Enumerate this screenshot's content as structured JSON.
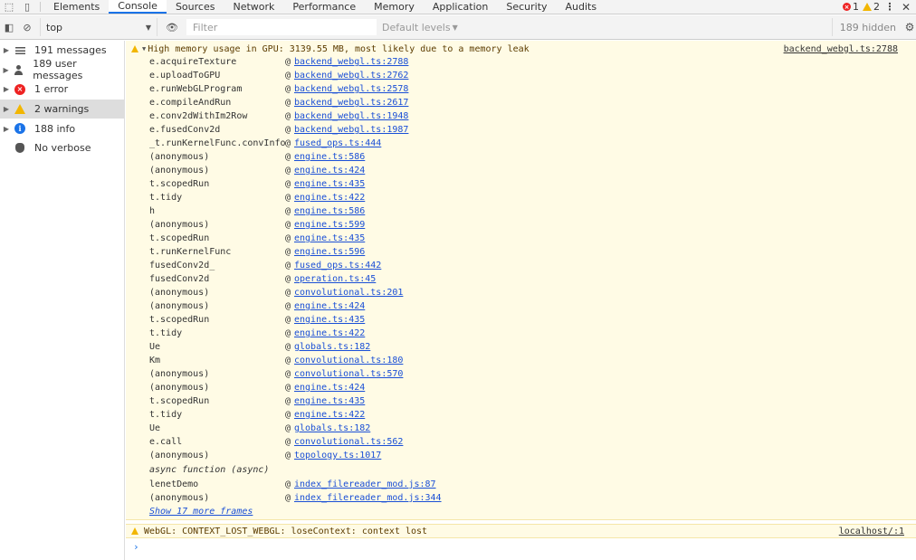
{
  "tabs": [
    "Elements",
    "Console",
    "Sources",
    "Network",
    "Performance",
    "Memory",
    "Application",
    "Security",
    "Audits"
  ],
  "active_tab": "Console",
  "status": {
    "errors": "1",
    "warnings": "2"
  },
  "toolbar": {
    "context": "top",
    "filter_placeholder": "Filter",
    "levels": "Default levels",
    "hidden": "189 hidden"
  },
  "sidebar": {
    "items": [
      {
        "label": "191 messages",
        "icon": "list-icon"
      },
      {
        "label": "189 user messages",
        "icon": "user-icon"
      },
      {
        "label": "1 error",
        "icon": "error-icon"
      },
      {
        "label": "2 warnings",
        "icon": "warning-icon"
      },
      {
        "label": "188 info",
        "icon": "info-icon"
      },
      {
        "label": "No verbose",
        "icon": "bug-icon"
      }
    ]
  },
  "warning": {
    "message": "High memory usage in GPU: 3139.55 MB, most likely due to a memory leak",
    "source": "backend_webgl.ts:2788",
    "frames": [
      {
        "fn": "e.acquireTexture",
        "link": "backend_webgl.ts:2788"
      },
      {
        "fn": "e.uploadToGPU",
        "link": "backend_webgl.ts:2762"
      },
      {
        "fn": "e.runWebGLProgram",
        "link": "backend_webgl.ts:2578"
      },
      {
        "fn": "e.compileAndRun",
        "link": "backend_webgl.ts:2617"
      },
      {
        "fn": "e.conv2dWithIm2Row",
        "link": "backend_webgl.ts:1948"
      },
      {
        "fn": "e.fusedConv2d",
        "link": "backend_webgl.ts:1987"
      },
      {
        "fn": "_t.runKernelFunc.convInfo",
        "link": "fused_ops.ts:444"
      },
      {
        "fn": "(anonymous)",
        "link": "engine.ts:586"
      },
      {
        "fn": "(anonymous)",
        "link": "engine.ts:424"
      },
      {
        "fn": "t.scopedRun",
        "link": "engine.ts:435"
      },
      {
        "fn": "t.tidy",
        "link": "engine.ts:422"
      },
      {
        "fn": "h",
        "link": "engine.ts:586"
      },
      {
        "fn": "(anonymous)",
        "link": "engine.ts:599"
      },
      {
        "fn": "t.scopedRun",
        "link": "engine.ts:435"
      },
      {
        "fn": "t.runKernelFunc",
        "link": "engine.ts:596"
      },
      {
        "fn": "fusedConv2d_",
        "link": "fused_ops.ts:442"
      },
      {
        "fn": "fusedConv2d",
        "link": "operation.ts:45"
      },
      {
        "fn": "(anonymous)",
        "link": "convolutional.ts:201"
      },
      {
        "fn": "(anonymous)",
        "link": "engine.ts:424"
      },
      {
        "fn": "t.scopedRun",
        "link": "engine.ts:435"
      },
      {
        "fn": "t.tidy",
        "link": "engine.ts:422"
      },
      {
        "fn": "Ue",
        "link": "globals.ts:182"
      },
      {
        "fn": "Km",
        "link": "convolutional.ts:180"
      },
      {
        "fn": "(anonymous)",
        "link": "convolutional.ts:570"
      },
      {
        "fn": "(anonymous)",
        "link": "engine.ts:424"
      },
      {
        "fn": "t.scopedRun",
        "link": "engine.ts:435"
      },
      {
        "fn": "t.tidy",
        "link": "engine.ts:422"
      },
      {
        "fn": "Ue",
        "link": "globals.ts:182"
      },
      {
        "fn": "e.call",
        "link": "convolutional.ts:562"
      },
      {
        "fn": "(anonymous)",
        "link": "topology.ts:1017"
      }
    ],
    "async_label": "async function (async)",
    "async_frames": [
      {
        "fn": "lenetDemo",
        "link": "index_filereader_mod.js:87"
      },
      {
        "fn": "(anonymous)",
        "link": "index_filereader_mod.js:344"
      }
    ],
    "more_frames": "Show 17 more frames"
  },
  "webgl_warning": {
    "message": "WebGL: CONTEXT_LOST_WEBGL: loseContext: context lost",
    "source": "localhost/:1"
  },
  "prompt_symbol": "›"
}
